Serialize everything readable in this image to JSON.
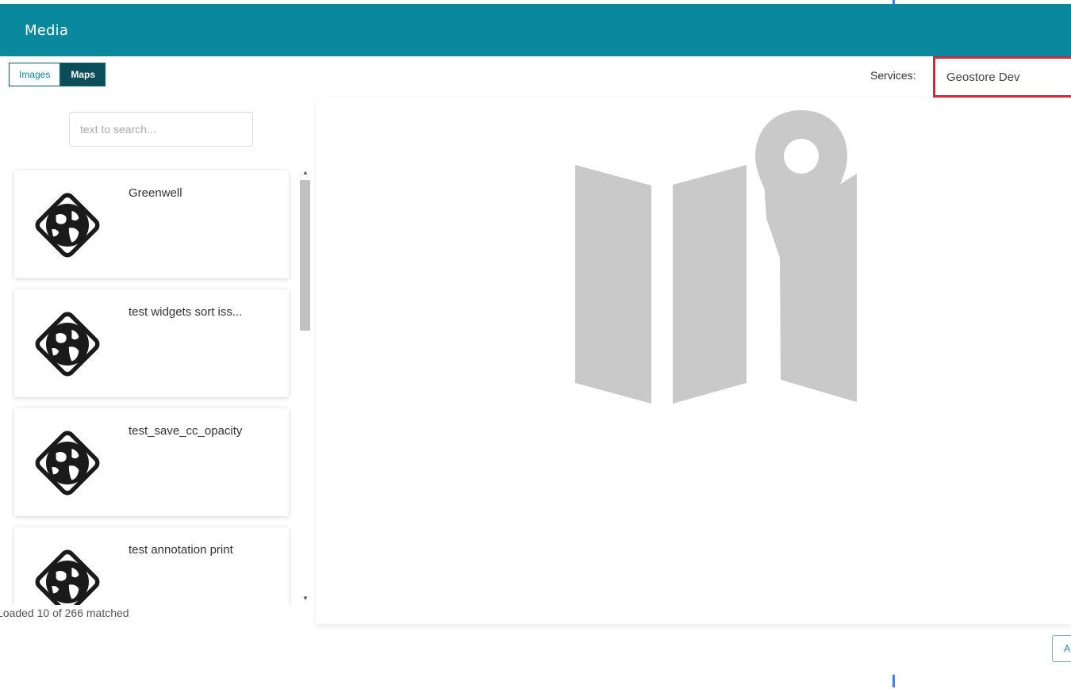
{
  "header": {
    "title": "Media"
  },
  "tabs": [
    {
      "label": "Images",
      "active": false
    },
    {
      "label": "Maps",
      "active": true
    }
  ],
  "services": {
    "label": "Services:",
    "selected": "Geostore Dev"
  },
  "search": {
    "placeholder": "text to search..."
  },
  "maps": [
    {
      "name": "Greenwell",
      "icon": "globe-diamond-icon"
    },
    {
      "name": "test widgets sort iss...",
      "icon": "globe-diamond-icon"
    },
    {
      "name": "test_save_cc_opacity",
      "icon": "globe-diamond-icon"
    },
    {
      "name": "test annotation print",
      "icon": "globe-diamond-icon"
    }
  ],
  "status": {
    "text": "Loaded 10 of 266 matched"
  },
  "preview": {
    "icon": "map-pin-placeholder-icon"
  },
  "bottom_button": {
    "label": "A"
  },
  "colors": {
    "header": "#0a899e",
    "active_tab": "#0b4e5a",
    "highlight": "#d12b3a",
    "placeholder_art": "#c9c9c9"
  }
}
